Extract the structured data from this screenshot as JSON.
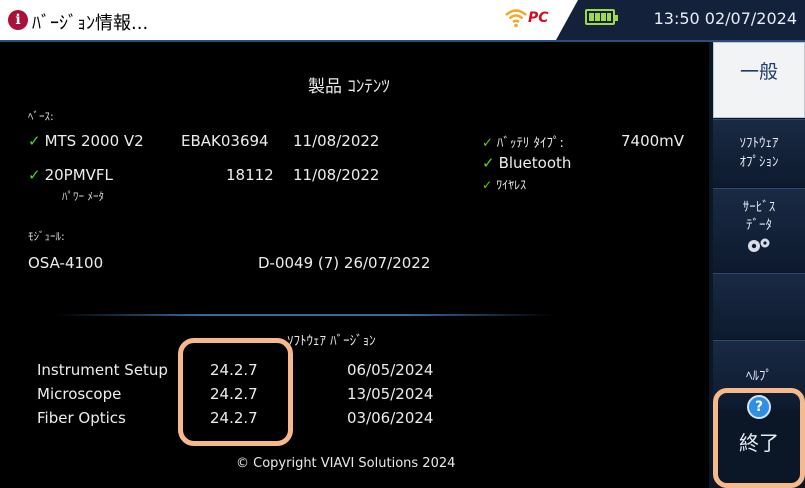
{
  "header": {
    "info_icon": "i",
    "title": "ﾊﾞｰｼﾞｮﾝ情報...",
    "pc_badge": "PC",
    "clock": "13:50 02/07/2024"
  },
  "product": {
    "heading": "製品 ｺﾝﾃﾝﾂ",
    "base_label": "ﾍﾞｰｽ:",
    "base_row": {
      "name": "MTS 2000 V2",
      "serial": "EBAK03694",
      "date": "11/08/2022"
    },
    "pm_row": {
      "name": "20PMVFL",
      "sub": "ﾊﾟﾜｰ ﾒｰﾀ",
      "serial": "18112",
      "date": "11/08/2022"
    },
    "battery_label": "ﾊﾞｯﾃﾘ ﾀｲﾌﾟ:",
    "battery_value": "7400mV",
    "bluetooth": "Bluetooth",
    "wireless": "ﾜｲﾔﾚｽ",
    "module_label": "ﾓｼﾞｭｰﾙ:",
    "module_row": {
      "name": "OSA-4100",
      "detail": "D-0049 (7) 26/07/2022"
    }
  },
  "software": {
    "heading": "ｿﾌﾄｳｪｱ ﾊﾞｰｼﾞｮﾝ",
    "rows": [
      {
        "name": "Instrument Setup",
        "version": "24.2.7",
        "date": "06/05/2024"
      },
      {
        "name": "Microscope",
        "version": "24.2.7",
        "date": "13/05/2024"
      },
      {
        "name": "Fiber Optics",
        "version": "24.2.7",
        "date": "03/06/2024"
      }
    ]
  },
  "copyright": "© Copyright VIAVI Solutions 2024",
  "sidebar": {
    "general": "一般",
    "software_option_1": "ｿﾌﾄｳｪｱ",
    "software_option_2": "ｵﾌﾟｼｮﾝ",
    "service_data_1": "ｻｰﾋﾞｽ",
    "service_data_2": "ﾃﾞｰﾀ",
    "help": "ﾍﾙﾌﾟ",
    "help_icon": "?",
    "exit": "終了"
  },
  "colors": {
    "accent": "#2c4f7a",
    "check": "#5cd21a",
    "highlight": "#f6b98c"
  }
}
